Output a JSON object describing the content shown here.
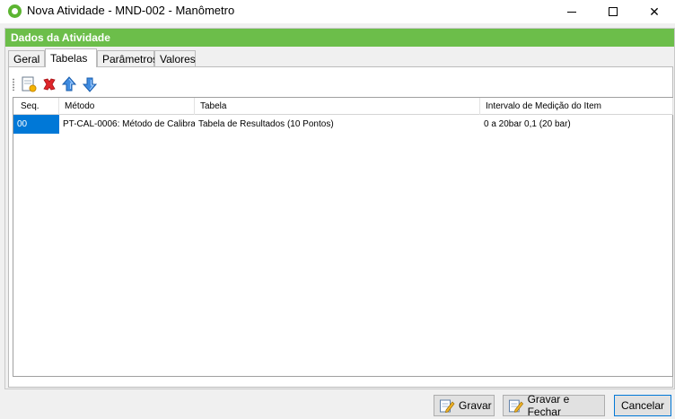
{
  "window": {
    "title": "Nova Atividade - MND-002 - Manômetro",
    "minimize_label": "",
    "maximize_label": "",
    "close_label": "✕"
  },
  "section": {
    "header": "Dados da Atividade"
  },
  "tabs": [
    {
      "label": "Geral",
      "active": false
    },
    {
      "label": "Tabelas",
      "active": true
    },
    {
      "label": "Parâmetros",
      "active": false
    },
    {
      "label": "Valores",
      "active": false
    }
  ],
  "toolbar": {
    "icons": [
      "new-row-icon",
      "delete-icon",
      "arrow-up-icon",
      "arrow-down-icon"
    ]
  },
  "grid": {
    "columns": [
      "Seq.",
      "Método",
      "Tabela",
      "Intervalo de Medição do Item"
    ],
    "rows": [
      [
        "00",
        "PT-CAL-0006: Método de Calibra…",
        "Tabela de Resultados (10 Pontos)",
        "0 a 20bar 0,1 (20 bar)"
      ]
    ]
  },
  "buttons": {
    "save": "Gravar",
    "save_close": "Gravar e Fechar",
    "cancel": "Cancelar"
  },
  "colors": {
    "header_green": "#6cbe4a",
    "selection_blue": "#0078d7"
  }
}
